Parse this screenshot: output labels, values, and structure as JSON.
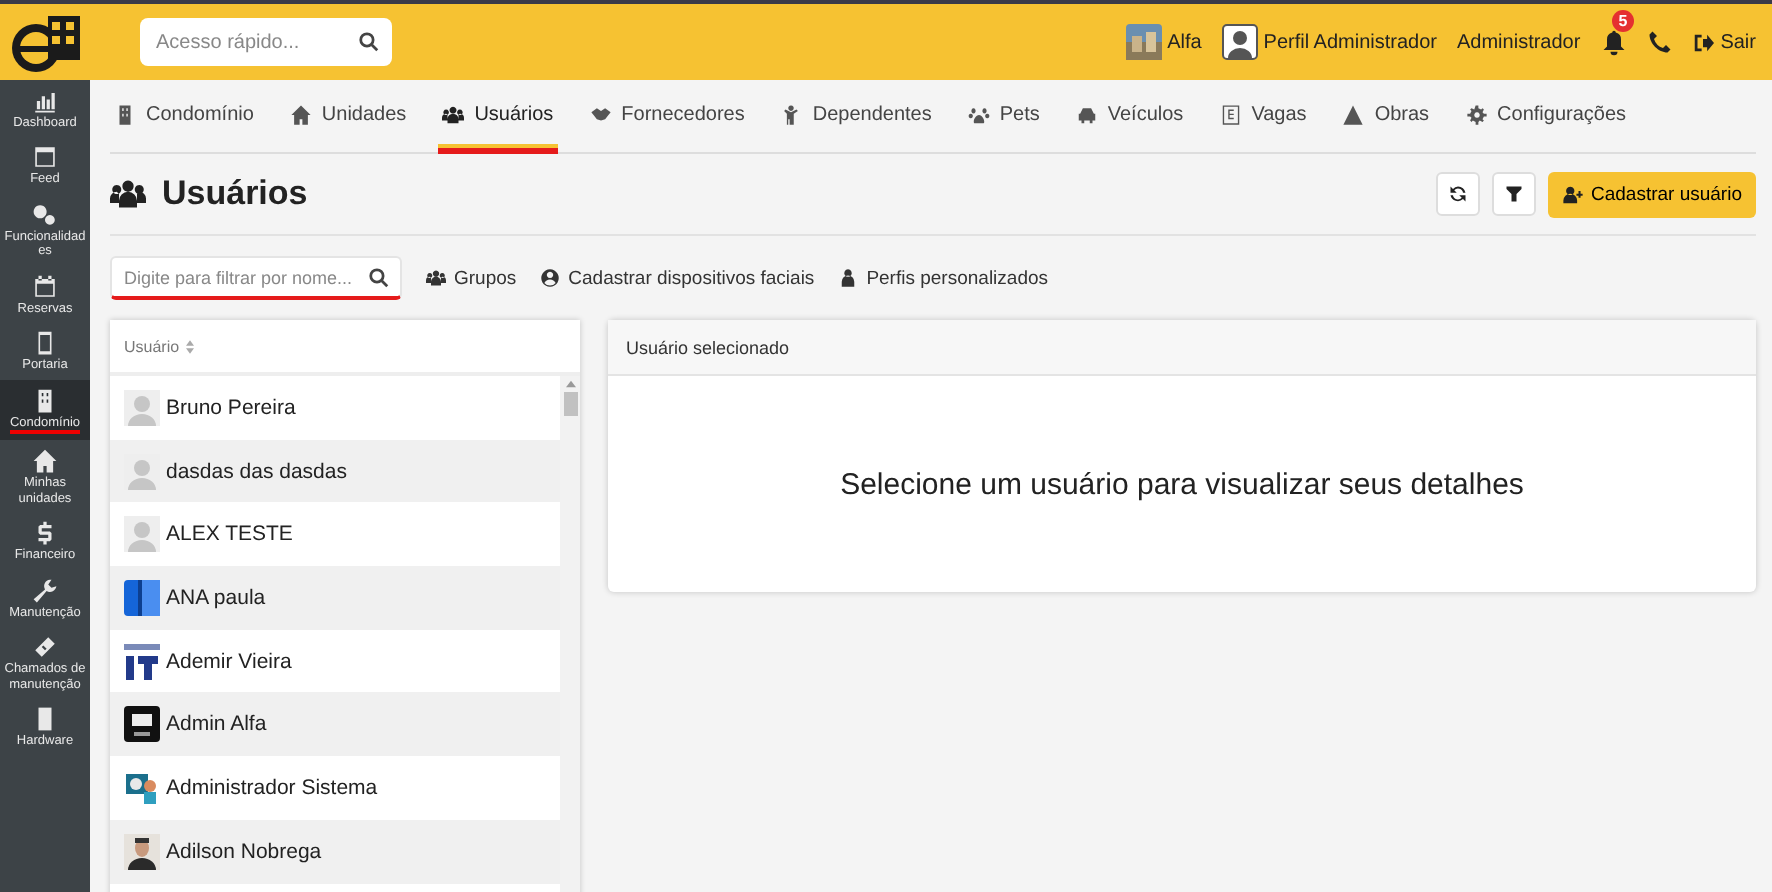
{
  "topbar": {
    "search": {
      "placeholder": "Acesso rápido..."
    },
    "condo": "Alfa",
    "profile": "Perfil Administrador",
    "user": "Administrador",
    "notifications": "5",
    "logout": "Sair"
  },
  "sidebar": {
    "items": [
      {
        "label": "Dashboard",
        "selected": false
      },
      {
        "label": "Feed",
        "selected": false
      },
      {
        "label": "Funcionalidades",
        "selected": false
      },
      {
        "label": "Reservas",
        "selected": false
      },
      {
        "label": "Portaria",
        "selected": false
      },
      {
        "label": "Condomínio",
        "selected": true
      },
      {
        "label": "Minhas unidades",
        "selected": false
      },
      {
        "label": "Financeiro",
        "selected": false
      },
      {
        "label": "Manutenção",
        "selected": false
      },
      {
        "label": "Chamados de manutenção",
        "selected": false
      },
      {
        "label": "Hardware",
        "selected": false
      }
    ]
  },
  "tabs": [
    {
      "label": "Condomínio",
      "selected": false
    },
    {
      "label": "Unidades",
      "selected": false
    },
    {
      "label": "Usuários",
      "selected": true
    },
    {
      "label": "Fornecedores",
      "selected": false
    },
    {
      "label": "Dependentes",
      "selected": false
    },
    {
      "label": "Pets",
      "selected": false
    },
    {
      "label": "Veículos",
      "selected": false
    },
    {
      "label": "Vagas",
      "selected": false
    },
    {
      "label": "Obras",
      "selected": false
    },
    {
      "label": "Configurações",
      "selected": false
    }
  ],
  "page": {
    "title": "Usuários",
    "add_button": "Cadastrar usuário"
  },
  "filter": {
    "placeholder": "Digite para filtrar por nome...",
    "links": [
      "Grupos",
      "Cadastrar dispositivos faciais",
      "Perfis personalizados"
    ]
  },
  "table": {
    "columns": [
      "Usuário"
    ],
    "rows": [
      "Bruno Pereira",
      "dasdas das dasdas",
      "ALEX TESTE",
      "ANA paula",
      "Ademir Vieira",
      "Admin Alfa",
      "Administrador Sistema",
      "Adilson Nobrega"
    ]
  },
  "details": {
    "header": "Usuário selecionado",
    "message": "Selecione um usuário para visualizar seus detalhes"
  }
}
